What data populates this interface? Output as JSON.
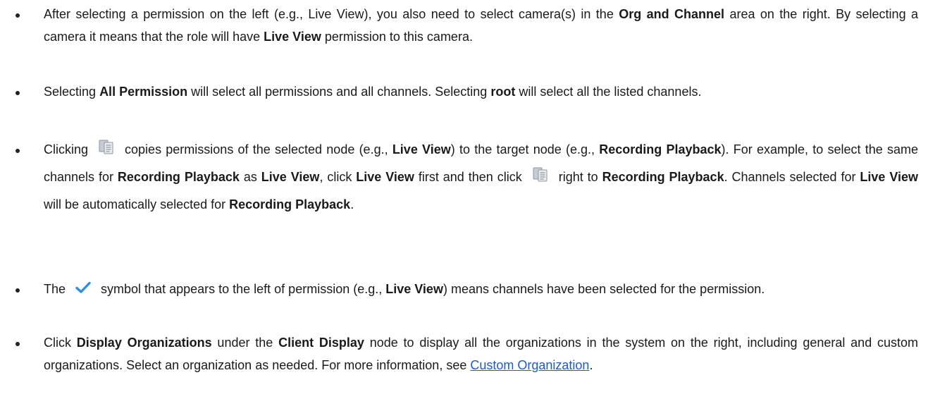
{
  "bullets": [
    {
      "id": "permission-select",
      "parts": [
        "After selecting a permission on the left (e.g., Live View), you also need to select camera(s) in the ",
        "Org and Channel",
        " area on the right. By selecting a camera it means that the role will have ",
        "Live View",
        " permission to this camera."
      ]
    },
    {
      "id": "all-permission",
      "parts": [
        "Selecting ",
        "All Permission",
        " will select all permissions and all channels. Selecting ",
        "root",
        " will select all the listed channels."
      ]
    },
    {
      "id": "copy-permissions",
      "parts": [
        "Clicking",
        "copies permissions of the selected node (e.g., ",
        "Live View",
        ") to the target node (e.g., ",
        "Recording Playback",
        "). For example, to select the same channels for ",
        "Recording Playback",
        " as ",
        "Live View",
        ", click ",
        "Live View",
        " first and then click",
        "right to ",
        "Recording Playback",
        ". Channels selected for ",
        "Live View",
        " will be automatically selected for ",
        "Recording Playback",
        "."
      ]
    },
    {
      "id": "check-symbol",
      "parts": [
        "The",
        "symbol that appears to the left of permission (e.g., ",
        "Live View",
        ") means channels have been selected for the permission."
      ]
    },
    {
      "id": "display-orgs",
      "parts": [
        "Click ",
        "Display Organizations",
        " under the ",
        "Client Display",
        " node to display all the organizations in the system on the right, including general and custom organizations. Select an organization as needed. For more information, see ",
        "Custom Organization",
        "."
      ]
    }
  ],
  "icons": {
    "copy": "copy-permissions-icon",
    "check": "checkmark-icon"
  },
  "colors": {
    "link": "#1a5bd0",
    "check": "#2f8ee0",
    "copy_icon": "#9aa3ad"
  }
}
